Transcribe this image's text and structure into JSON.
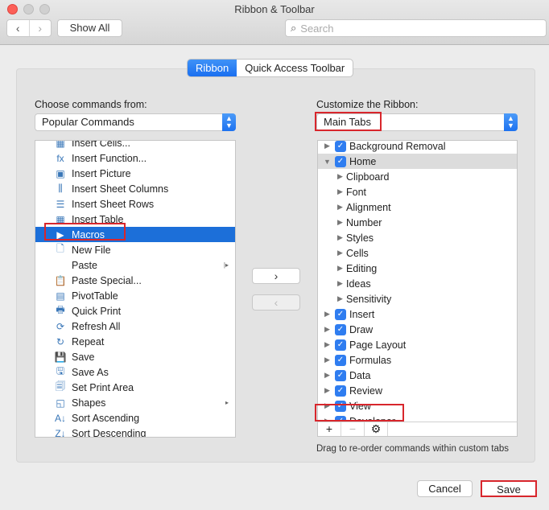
{
  "window": {
    "title": "Ribbon & Toolbar"
  },
  "toolbar": {
    "back": "‹",
    "forward": "›",
    "show_all": "Show All",
    "search_placeholder": "Search",
    "search_icon": "search-icon"
  },
  "tabs": [
    {
      "label": "Ribbon",
      "active": true
    },
    {
      "label": "Quick Access Toolbar",
      "active": false
    }
  ],
  "left": {
    "label": "Choose commands from:",
    "select_value": "Popular Commands",
    "items": [
      {
        "label": "Insert Cells...",
        "icon": "insert-cells-icon",
        "glyph": "▦"
      },
      {
        "label": "Insert Function...",
        "icon": "function-icon",
        "glyph": "fx"
      },
      {
        "label": "Insert Picture",
        "icon": "picture-icon",
        "glyph": "▣"
      },
      {
        "label": "Insert Sheet Columns",
        "icon": "insert-columns-icon",
        "glyph": "⫼"
      },
      {
        "label": "Insert Sheet Rows",
        "icon": "insert-rows-icon",
        "glyph": "☰"
      },
      {
        "label": "Insert Table",
        "icon": "table-icon",
        "glyph": "▦"
      },
      {
        "label": "Macros",
        "icon": "play-icon",
        "glyph": "▶",
        "selected": true
      },
      {
        "label": "New File",
        "icon": "new-file-icon",
        "glyph": "🗋"
      },
      {
        "label": "Paste",
        "icon": "",
        "glyph": "",
        "submenu": "split"
      },
      {
        "label": "Paste Special...",
        "icon": "paste-special-icon",
        "glyph": "📋"
      },
      {
        "label": "PivotTable",
        "icon": "pivot-table-icon",
        "glyph": "▤"
      },
      {
        "label": "Quick Print",
        "icon": "print-icon",
        "glyph": "🖶"
      },
      {
        "label": "Refresh All",
        "icon": "refresh-icon",
        "glyph": "⟳"
      },
      {
        "label": "Repeat",
        "icon": "repeat-icon",
        "glyph": "↻"
      },
      {
        "label": "Save",
        "icon": "save-icon",
        "glyph": "💾"
      },
      {
        "label": "Save As",
        "icon": "save-as-icon",
        "glyph": "🖫"
      },
      {
        "label": "Set Print Area",
        "icon": "print-area-icon",
        "glyph": "🗐"
      },
      {
        "label": "Shapes",
        "icon": "shapes-icon",
        "glyph": "◱",
        "submenu": "arrow"
      },
      {
        "label": "Sort Ascending",
        "icon": "sort-ascending-icon",
        "glyph": "A↓"
      },
      {
        "label": "Sort Descending",
        "icon": "sort-descending-icon",
        "glyph": "Z↓"
      }
    ]
  },
  "middle": {
    "add": "›",
    "remove": "‹"
  },
  "right": {
    "label": "Customize the Ribbon:",
    "select_value": "Main Tabs",
    "items": [
      {
        "label": "Background Removal",
        "level": 0,
        "checked": true,
        "expanded": false
      },
      {
        "label": "Home",
        "level": 0,
        "checked": true,
        "expanded": true,
        "highlighted": true
      },
      {
        "label": "Clipboard",
        "level": 1
      },
      {
        "label": "Font",
        "level": 1
      },
      {
        "label": "Alignment",
        "level": 1
      },
      {
        "label": "Number",
        "level": 1
      },
      {
        "label": "Styles",
        "level": 1
      },
      {
        "label": "Cells",
        "level": 1
      },
      {
        "label": "Editing",
        "level": 1
      },
      {
        "label": "Ideas",
        "level": 1
      },
      {
        "label": "Sensitivity",
        "level": 1
      },
      {
        "label": "Insert",
        "level": 0,
        "checked": true
      },
      {
        "label": "Draw",
        "level": 0,
        "checked": true
      },
      {
        "label": "Page Layout",
        "level": 0,
        "checked": true
      },
      {
        "label": "Formulas",
        "level": 0,
        "checked": true
      },
      {
        "label": "Data",
        "level": 0,
        "checked": true
      },
      {
        "label": "Review",
        "level": 0,
        "checked": true
      },
      {
        "label": "View",
        "level": 0,
        "checked": true
      },
      {
        "label": "Developer",
        "level": 0,
        "checked": true
      }
    ],
    "toolbar": {
      "add": "+",
      "remove": "−",
      "settings": "⚙"
    },
    "hint": "Drag to re-order commands within custom tabs"
  },
  "footer": {
    "cancel": "Cancel",
    "save": "Save"
  },
  "colors": {
    "accent": "#1c6fd9",
    "highlight_box": "#d8262c",
    "checkbox": "#2f7df0"
  }
}
